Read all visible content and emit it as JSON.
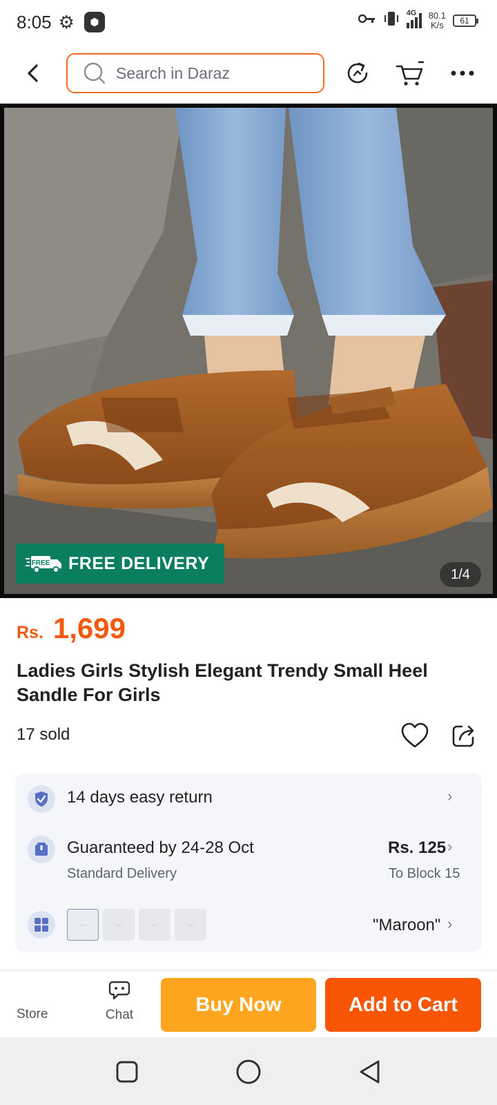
{
  "status_bar": {
    "time": "8:05",
    "network_speed_value": "80.1",
    "network_speed_unit": "K/s",
    "network_type": "4G",
    "battery": "61"
  },
  "header": {
    "search_placeholder": "Search in Daraz",
    "icons": [
      "back-icon",
      "search-icon",
      "refresh-icon",
      "cart-icon",
      "more-icon"
    ]
  },
  "gallery": {
    "badge_label": "FREE DELIVERY",
    "truck_label": "FREE",
    "counter": "1/4"
  },
  "product": {
    "currency": "Rs.",
    "price": "1,699",
    "title": "Ladies Girls Stylish Elegant Trendy Small Heel Sandle For Girls",
    "sold": "17 sold"
  },
  "info": {
    "return_label": "14 days easy return",
    "delivery_title": "Guaranteed by 24-28 Oct",
    "delivery_sub": "Standard Delivery",
    "delivery_price": "Rs. 125",
    "delivery_location": "To Block 15",
    "variant_selected": "\"Maroon\"",
    "swatch_count": 4
  },
  "bottom_bar": {
    "store_label": "Store",
    "chat_label": "Chat",
    "buy_now_label": "Buy Now",
    "add_to_cart_label": "Add to Cart"
  },
  "colors": {
    "accent_orange": "#f85606",
    "buy_now_yellow": "#fda51e",
    "price_orange": "#f25a10",
    "free_delivery_green": "#0b7d60"
  }
}
